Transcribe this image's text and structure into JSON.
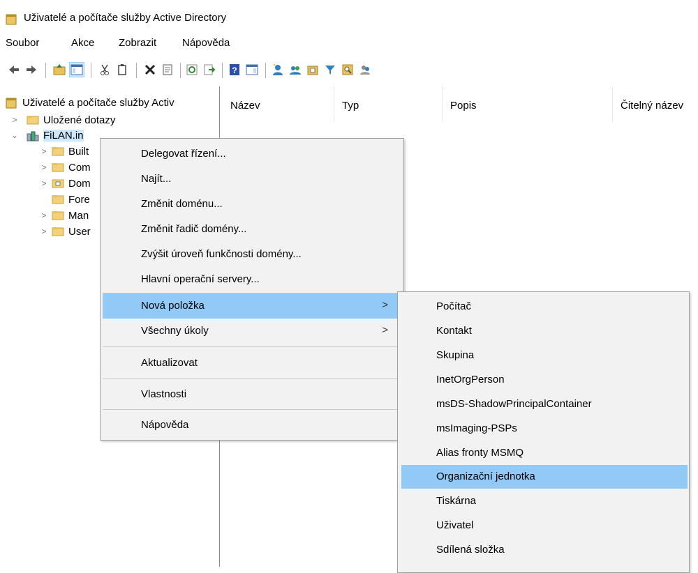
{
  "window": {
    "title": "Uživatelé a počítače služby Active Directory"
  },
  "menubar": {
    "items": [
      "Soubor",
      "Akce",
      "Zobrazit",
      "Nápověda"
    ]
  },
  "toolbar": {
    "icons": [
      "back-arrow-icon",
      "forward-arrow-icon",
      "up-folder-icon",
      "show-tree-icon",
      "cut-icon",
      "copy-icon",
      "delete-icon",
      "properties-icon",
      "refresh-icon",
      "export-list-icon",
      "help-icon",
      "show-action-pane-icon",
      "new-user-icon",
      "new-group-icon",
      "new-ou-icon",
      "filter-icon",
      "find-icon",
      "add-to-group-icon"
    ]
  },
  "tree": {
    "root": "Uživatelé a počítače služby Activ",
    "saved_queries": "Uložené dotazy",
    "domain": "FiLAN.in",
    "children": [
      "Built",
      "Com",
      "Dom",
      "Fore",
      "Man",
      "User"
    ]
  },
  "list": {
    "columns": [
      "Název",
      "Typ",
      "Popis",
      "Čitelný název"
    ]
  },
  "context_menu": {
    "items": [
      "Delegovat řízení...",
      "Najít...",
      "Změnit doménu...",
      "Změnit řadič domény...",
      "Zvýšit úroveň funkčnosti domény...",
      "Hlavní operační servery...",
      "Nová položka",
      "Všechny úkoly",
      "Aktualizovat",
      "Vlastnosti",
      "Nápověda"
    ],
    "submenu_arrow": ">"
  },
  "submenu": {
    "items": [
      "Počítač",
      "Kontakt",
      "Skupina",
      "InetOrgPerson",
      "msDS-ShadowPrincipalContainer",
      "msImaging-PSPs",
      "Alias fronty MSMQ",
      "Organizační jednotka",
      "Tiskárna",
      "Uživatel",
      "Sdílená složka"
    ]
  },
  "colors": {
    "highlight": "#91c9f7",
    "menu_bg": "#f2f2f2",
    "folder": "#f2d17a"
  }
}
